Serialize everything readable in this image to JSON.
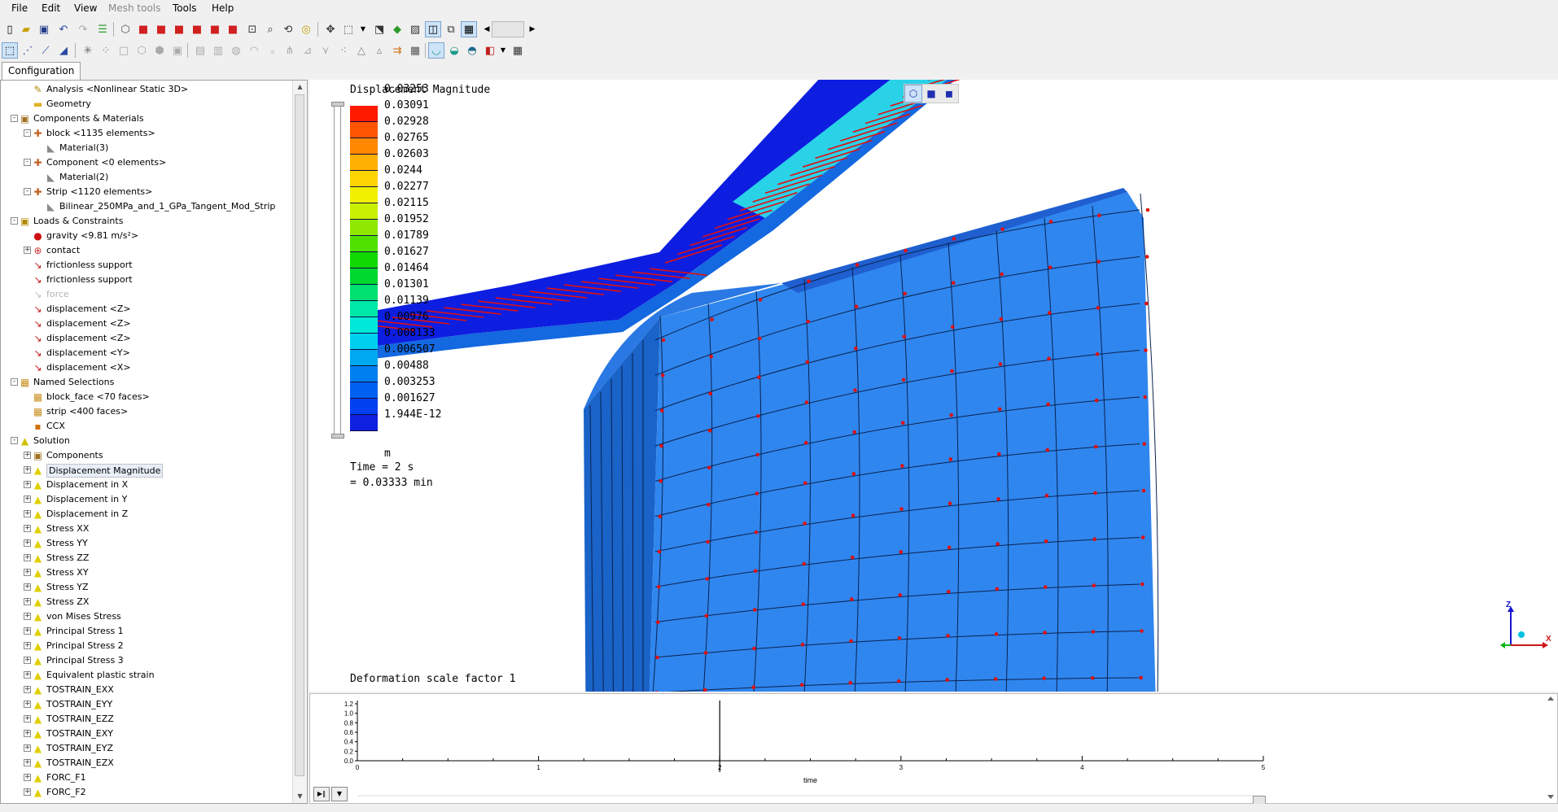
{
  "menu": [
    {
      "label": "File",
      "disabled": false
    },
    {
      "label": "Edit",
      "disabled": false
    },
    {
      "label": "View",
      "disabled": false
    },
    {
      "label": "Mesh tools",
      "disabled": true
    },
    {
      "label": "Tools",
      "disabled": false
    },
    {
      "label": "Help",
      "disabled": false
    }
  ],
  "toolbar1_icons": [
    "new-file",
    "open-folder",
    "save",
    "undo",
    "redo",
    "mesh-bars",
    "wireframe-cube",
    "red-cube",
    "red-cube-front",
    "red-cube-back",
    "red-cube-left",
    "red-cube-right",
    "red-cube-top",
    "zoom-box",
    "zoom",
    "rotate",
    "pan",
    "fit",
    "dropdown",
    "bottom-view",
    "iso-view",
    "surface-view",
    "front-view",
    "wire-view",
    "hidden-line",
    "slider-left",
    "slider",
    "slider-right"
  ],
  "toolbar2_icons": [
    "select-box",
    "select-vertex",
    "select-edge",
    "select-face",
    "explode",
    "point",
    "box",
    "cube",
    "cube-outline",
    "small-cube",
    "box-gray",
    "cylinder",
    "sphere",
    "torus",
    "tree",
    "scissors",
    "triangle",
    "triangle-outline",
    "arrows",
    "grid",
    "result-bowl",
    "result-bowl-green",
    "result-bowl-mesh",
    "dropdown",
    "table"
  ],
  "tabs": {
    "configuration": "Configuration"
  },
  "tree": [
    {
      "label": "Analysis <Nonlinear Static 3D>",
      "level": 1,
      "icon": "analysis-icon",
      "toggle": "",
      "dim": false
    },
    {
      "label": "Geometry",
      "level": 1,
      "icon": "folder-icon",
      "toggle": "",
      "dim": false
    },
    {
      "label": "Components & Materials",
      "level": 0,
      "icon": "components-icon",
      "toggle": "-",
      "dim": false
    },
    {
      "label": "block <1135 elements>",
      "level": 1,
      "icon": "component-icon",
      "toggle": "-",
      "dim": false
    },
    {
      "label": "Material(3)",
      "level": 2,
      "icon": "material-icon",
      "toggle": "",
      "dim": false
    },
    {
      "label": "Component <0 elements>",
      "level": 1,
      "icon": "component-icon",
      "toggle": "-",
      "dim": false
    },
    {
      "label": "Material(2)",
      "level": 2,
      "icon": "material-icon",
      "toggle": "",
      "dim": false
    },
    {
      "label": "Strip <1120 elements>",
      "level": 1,
      "icon": "component-icon",
      "toggle": "-",
      "dim": false
    },
    {
      "label": "Bilinear_250MPa_and_1_GPa_Tangent_Mod_Strip",
      "level": 2,
      "icon": "material-icon",
      "toggle": "",
      "dim": false
    },
    {
      "label": "Loads & Constraints",
      "level": 0,
      "icon": "loads-icon",
      "toggle": "-",
      "dim": false
    },
    {
      "label": "gravity <9.81 m/s²>",
      "level": 1,
      "icon": "gravity-icon",
      "toggle": "",
      "dim": false
    },
    {
      "label": "contact",
      "level": 1,
      "icon": "contact-icon",
      "toggle": "+",
      "dim": false
    },
    {
      "label": "frictionless support",
      "level": 1,
      "icon": "support-icon",
      "toggle": "",
      "dim": false
    },
    {
      "label": "frictionless support",
      "level": 1,
      "icon": "support-icon",
      "toggle": "",
      "dim": false
    },
    {
      "label": "force",
      "level": 1,
      "icon": "force-icon",
      "toggle": "",
      "dim": true
    },
    {
      "label": "displacement <Z>",
      "level": 1,
      "icon": "displacement-icon",
      "toggle": "",
      "dim": false
    },
    {
      "label": "displacement <Z>",
      "level": 1,
      "icon": "displacement-icon",
      "toggle": "",
      "dim": false
    },
    {
      "label": "displacement <Z>",
      "level": 1,
      "icon": "displacement-icon",
      "toggle": "",
      "dim": false
    },
    {
      "label": "displacement <Y>",
      "level": 1,
      "icon": "displacement-icon",
      "toggle": "",
      "dim": false
    },
    {
      "label": "displacement <X>",
      "level": 1,
      "icon": "displacement-icon",
      "toggle": "",
      "dim": false
    },
    {
      "label": "Named Selections",
      "level": 0,
      "icon": "named-selection-icon",
      "toggle": "-",
      "dim": false
    },
    {
      "label": "block_face <70 faces>",
      "level": 1,
      "icon": "face-selection-icon",
      "toggle": "",
      "dim": false
    },
    {
      "label": "strip <400 faces>",
      "level": 1,
      "icon": "face-selection-icon",
      "toggle": "",
      "dim": false
    },
    {
      "label": "CCX",
      "level": 1,
      "icon": "ccx-icon",
      "toggle": "",
      "dim": false
    },
    {
      "label": "Solution",
      "level": 0,
      "icon": "solution-icon",
      "toggle": "-",
      "dim": false
    },
    {
      "label": "Components",
      "level": 1,
      "icon": "components-icon",
      "toggle": "+",
      "dim": false
    },
    {
      "label": "Displacement Magnitude",
      "level": 1,
      "icon": "result-icon",
      "toggle": "+",
      "dim": false,
      "selected": true
    },
    {
      "label": "Displacement in X",
      "level": 1,
      "icon": "result-icon",
      "toggle": "+",
      "dim": false
    },
    {
      "label": "Displacement in Y",
      "level": 1,
      "icon": "result-icon",
      "toggle": "+",
      "dim": false
    },
    {
      "label": "Displacement in Z",
      "level": 1,
      "icon": "result-icon",
      "toggle": "+",
      "dim": false
    },
    {
      "label": "Stress XX",
      "level": 1,
      "icon": "result-icon",
      "toggle": "+",
      "dim": false
    },
    {
      "label": "Stress YY",
      "level": 1,
      "icon": "result-icon",
      "toggle": "+",
      "dim": false
    },
    {
      "label": "Stress ZZ",
      "level": 1,
      "icon": "result-icon",
      "toggle": "+",
      "dim": false
    },
    {
      "label": "Stress XY",
      "level": 1,
      "icon": "result-icon",
      "toggle": "+",
      "dim": false
    },
    {
      "label": "Stress YZ",
      "level": 1,
      "icon": "result-icon",
      "toggle": "+",
      "dim": false
    },
    {
      "label": "Stress ZX",
      "level": 1,
      "icon": "result-icon",
      "toggle": "+",
      "dim": false
    },
    {
      "label": "von Mises Stress",
      "level": 1,
      "icon": "result-icon",
      "toggle": "+",
      "dim": false
    },
    {
      "label": "Principal Stress 1",
      "level": 1,
      "icon": "result-icon",
      "toggle": "+",
      "dim": false
    },
    {
      "label": "Principal Stress 2",
      "level": 1,
      "icon": "result-icon",
      "toggle": "+",
      "dim": false
    },
    {
      "label": "Principal Stress 3",
      "level": 1,
      "icon": "result-icon",
      "toggle": "+",
      "dim": false
    },
    {
      "label": "Equivalent plastic strain",
      "level": 1,
      "icon": "result-icon",
      "toggle": "+",
      "dim": false
    },
    {
      "label": "TOSTRAIN_EXX",
      "level": 1,
      "icon": "result-icon",
      "toggle": "+",
      "dim": false
    },
    {
      "label": "TOSTRAIN_EYY",
      "level": 1,
      "icon": "result-icon",
      "toggle": "+",
      "dim": false
    },
    {
      "label": "TOSTRAIN_EZZ",
      "level": 1,
      "icon": "result-icon",
      "toggle": "+",
      "dim": false
    },
    {
      "label": "TOSTRAIN_EXY",
      "level": 1,
      "icon": "result-icon",
      "toggle": "+",
      "dim": false
    },
    {
      "label": "TOSTRAIN_EYZ",
      "level": 1,
      "icon": "result-icon",
      "toggle": "+",
      "dim": false
    },
    {
      "label": "TOSTRAIN_EZX",
      "level": 1,
      "icon": "result-icon",
      "toggle": "+",
      "dim": false
    },
    {
      "label": "FORC_F1",
      "level": 1,
      "icon": "result-icon",
      "toggle": "+",
      "dim": false
    },
    {
      "label": "FORC_F2",
      "level": 1,
      "icon": "result-icon",
      "toggle": "+",
      "dim": false
    },
    {
      "label": "FORC_F3",
      "level": 1,
      "icon": "result-icon",
      "toggle": "+",
      "dim": false
    }
  ],
  "viewport": {
    "legend": {
      "title": "Displacement Magnitude",
      "values": [
        "0.03253",
        "0.03091",
        "0.02928",
        "0.02765",
        "0.02603",
        "0.0244",
        "0.02277",
        "0.02115",
        "0.01952",
        "0.01789",
        "0.01627",
        "0.01464",
        "0.01301",
        "0.01139",
        "0.00976",
        "0.008133",
        "0.006507",
        "0.00488",
        "0.003253",
        "0.001627",
        "1.944E-12"
      ],
      "colors": [
        "#ff1a00",
        "#ff5500",
        "#ff8800",
        "#ffb000",
        "#ffd400",
        "#f0f000",
        "#c8f000",
        "#90e800",
        "#50e000",
        "#10d800",
        "#00d830",
        "#00e070",
        "#00e8a8",
        "#00e8d8",
        "#00d0f0",
        "#00a8f0",
        "#0080f0",
        "#0060f0",
        "#0040f0",
        "#1020e0"
      ],
      "units": "m"
    },
    "time": {
      "line1": "Time = 2 s",
      "line2": "= 0.03333 min"
    },
    "deformation_label": "Deformation scale factor 1",
    "triad": {
      "x": "X",
      "y": "Y",
      "z": "Z"
    }
  },
  "chart_data": {
    "type": "line",
    "xlabel": "time",
    "xlim": [
      0,
      5
    ],
    "ylim": [
      0,
      1.2
    ],
    "x_ticks": [
      "0",
      "1",
      "2",
      "3",
      "4",
      "5"
    ],
    "y_ticks": [
      "0.0",
      "0.2",
      "0.4",
      "0.6",
      "0.8",
      "1.0",
      "1.2"
    ],
    "cursor_x": 2,
    "series": []
  },
  "colors": {
    "block": "#2f86ee",
    "block_side": "#1a63c8",
    "strip_dark": "#0d1ee0",
    "strip_mid": "#1468e0",
    "strip_light": "#2ad2e8",
    "node": "#e01010"
  }
}
